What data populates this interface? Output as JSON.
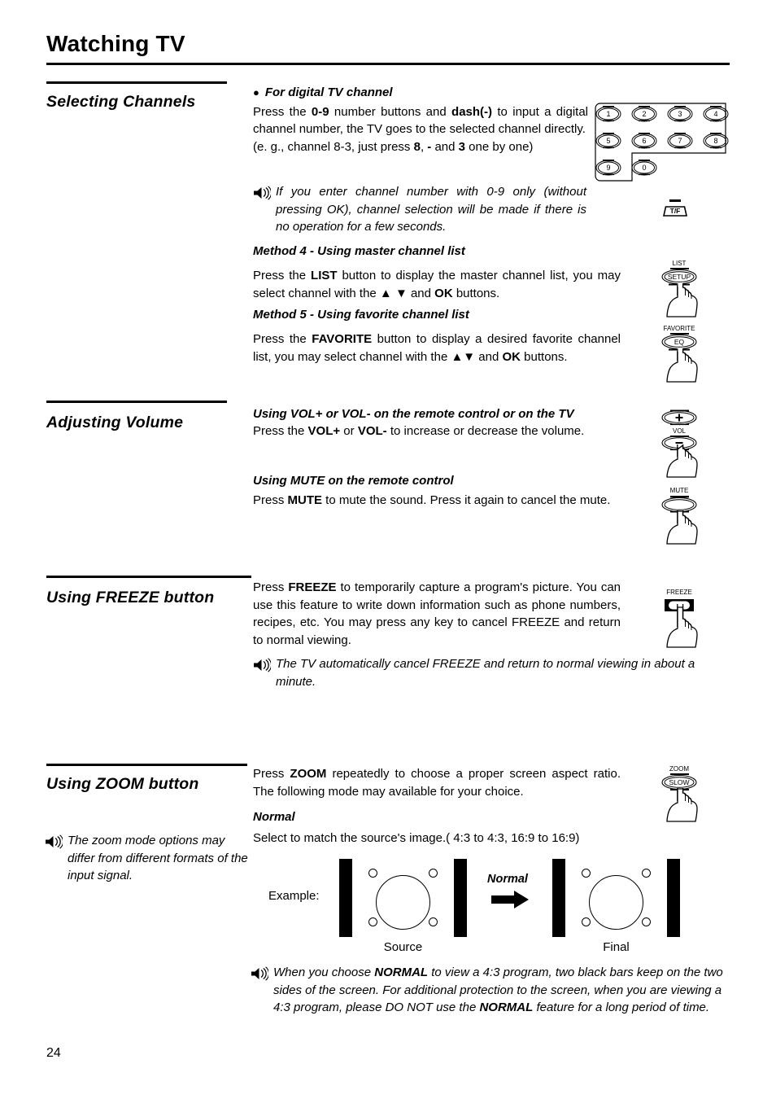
{
  "header": {
    "title": "Watching TV"
  },
  "page_number": "24",
  "sections": [
    {
      "heading": "Selecting Channels",
      "bullet_head": "For digital TV channel",
      "body_html": "Press the <b>0-9</b> number buttons and <b>dash(-)</b> to input a digital channel number, the TV goes to the selected channel directly.",
      "body_line2": "(e. g., channel 8-3, just press <b>8</b>, <b>-</b> and <b>3</b> one by one)",
      "note": "If you enter channel number with 0-9 only (without pressing OK), channel selection will be made if there is no operation for a few seconds.",
      "method4_head": "Method 4 - Using master channel list",
      "method4_body": "Press the <b>LIST</b> button to display the master channel list, you may select channel with the ▲ ▼ and <b>OK</b> buttons.",
      "method5_head": "Method 5 - Using favorite channel list",
      "method5_body": "Press the <b>FAVORITE</b> button to display a desired favorite channel list, you may select channel with the ▲▼ and <b>OK</b> buttons."
    },
    {
      "heading": "Adjusting Volume",
      "vol_head": "Using VOL+ or VOL- on the remote control or on the TV",
      "vol_body": "Press the <b>VOL+</b> or <b>VOL-</b> to increase or decrease the volume.",
      "mute_head": "Using MUTE on the remote control",
      "mute_body": "Press <b>MUTE</b> to mute the sound. Press it again to cancel the mute."
    },
    {
      "heading": "Using FREEZE button",
      "body": "Press <b>FREEZE</b> to temporarily capture a program's picture. You can use this feature to write down information such as phone numbers, recipes, etc. You may press any key to cancel FREEZE and return to normal viewing.",
      "note": "The TV automatically cancel FREEZE and return to normal viewing in about a minute."
    },
    {
      "heading": "Using ZOOM button",
      "side_note": "The zoom mode options may differ from different formats of the input signal.",
      "body": "Press <b>ZOOM</b> repeatedly to choose a proper screen aspect ratio. The following mode may available for your choice.",
      "mode_head": "Normal",
      "mode_body": "Select to match the source's image.( 4:3 to 4:3, 16:9 to 16:9)",
      "note": "When you choose <b>NORMAL</b> to view a 4:3 program, two black bars keep on the two sides of the screen. For additional protection to the screen, when you are viewing a 4:3 program, please DO NOT use the <b>NORMAL</b> feature for a long period of time."
    }
  ],
  "diagram": {
    "example_label": "Example:",
    "arrow_label": "Normal",
    "source_caption": "Source",
    "final_caption": "Final"
  },
  "remote_keys": {
    "keypad_digits": [
      "1",
      "2",
      "3",
      "4",
      "5",
      "6",
      "7",
      "8",
      "9",
      "0"
    ],
    "tf_label": "T/F",
    "list_top": "LIST",
    "list_main": "SETUP",
    "favorite_top": "FAVORITE",
    "favorite_main": "EQ",
    "vol_label": "VOL",
    "vol_plus": "+",
    "vol_minus": "–",
    "mute_label": "MUTE",
    "freeze_label": "FREEZE",
    "zoom_top": "ZOOM",
    "zoom_main": "SLOW"
  },
  "colors": {
    "ink": "#000000",
    "paper": "#ffffff"
  }
}
